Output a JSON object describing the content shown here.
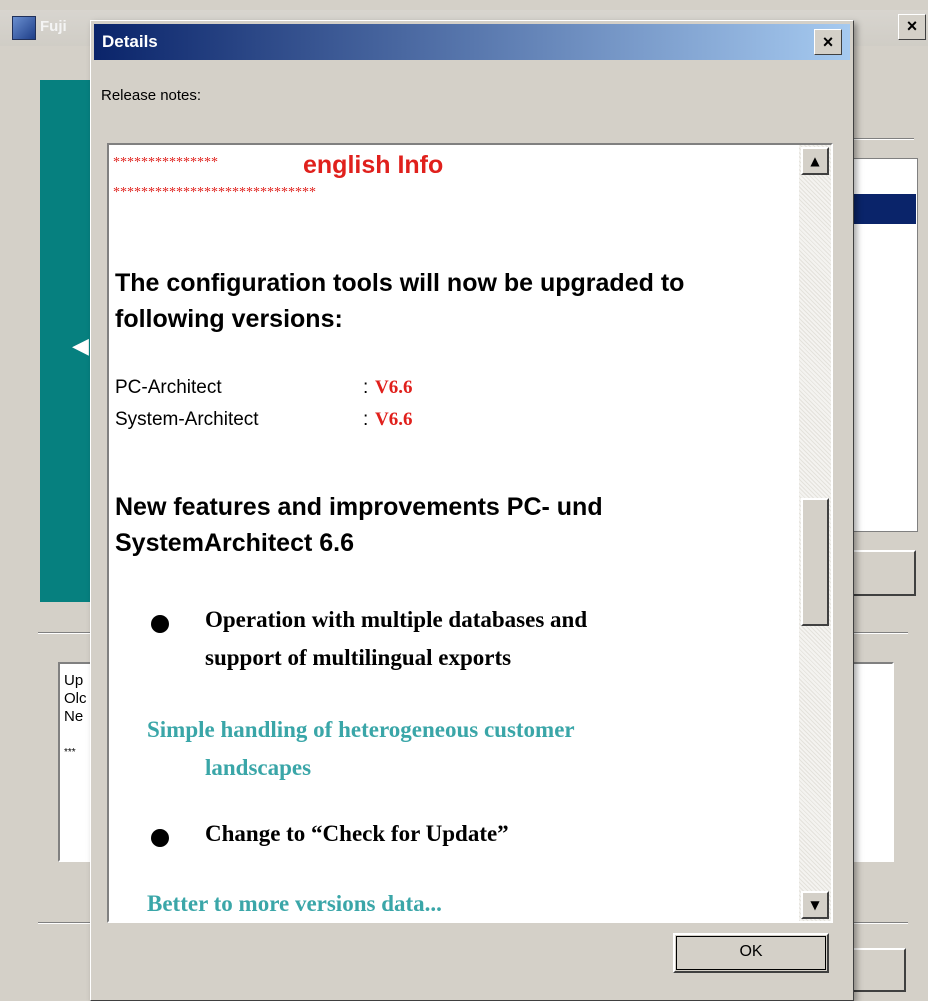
{
  "background_window": {
    "title": "Fuji",
    "close_label": "×",
    "log_lines": [
      "Up",
      "Olc",
      "Ne",
      "",
      "***"
    ]
  },
  "dialog": {
    "title": "Details",
    "close_label": "×",
    "release_label": "Release notes:",
    "ok_label": "OK"
  },
  "notes": {
    "stars_top": "***************",
    "english_info": "english Info",
    "stars_bottom": "*****************************",
    "heading1": "The configuration tools will now be upgraded to following versions:",
    "versions": [
      {
        "name": "PC-Architect",
        "sep": ":",
        "version": "V6.6"
      },
      {
        "name": "System-Architect",
        "sep": ":",
        "version": "V6.6"
      }
    ],
    "heading2": "New features and improvements PC- und SystemArchitect 6.6",
    "feature1_line1": "Operation with multiple databases and",
    "feature1_line2": "support of multilingual exports",
    "teal1_line1": "Simple handling of heterogeneous customer",
    "teal1_line2": "landscapes",
    "feature2": "Change to “Check for Update”",
    "teal2_partial": "Better to more versions data..."
  },
  "scrollbar": {
    "up_arrow": "▲",
    "down_arrow": "▼",
    "thumb_position": 0.55
  },
  "colors": {
    "title_bar_start": "#0a246a",
    "title_bar_end": "#a6caf0",
    "accent_red": "#e0201c",
    "accent_teal": "#3aa6a8",
    "window_face": "#d4d0c8"
  }
}
